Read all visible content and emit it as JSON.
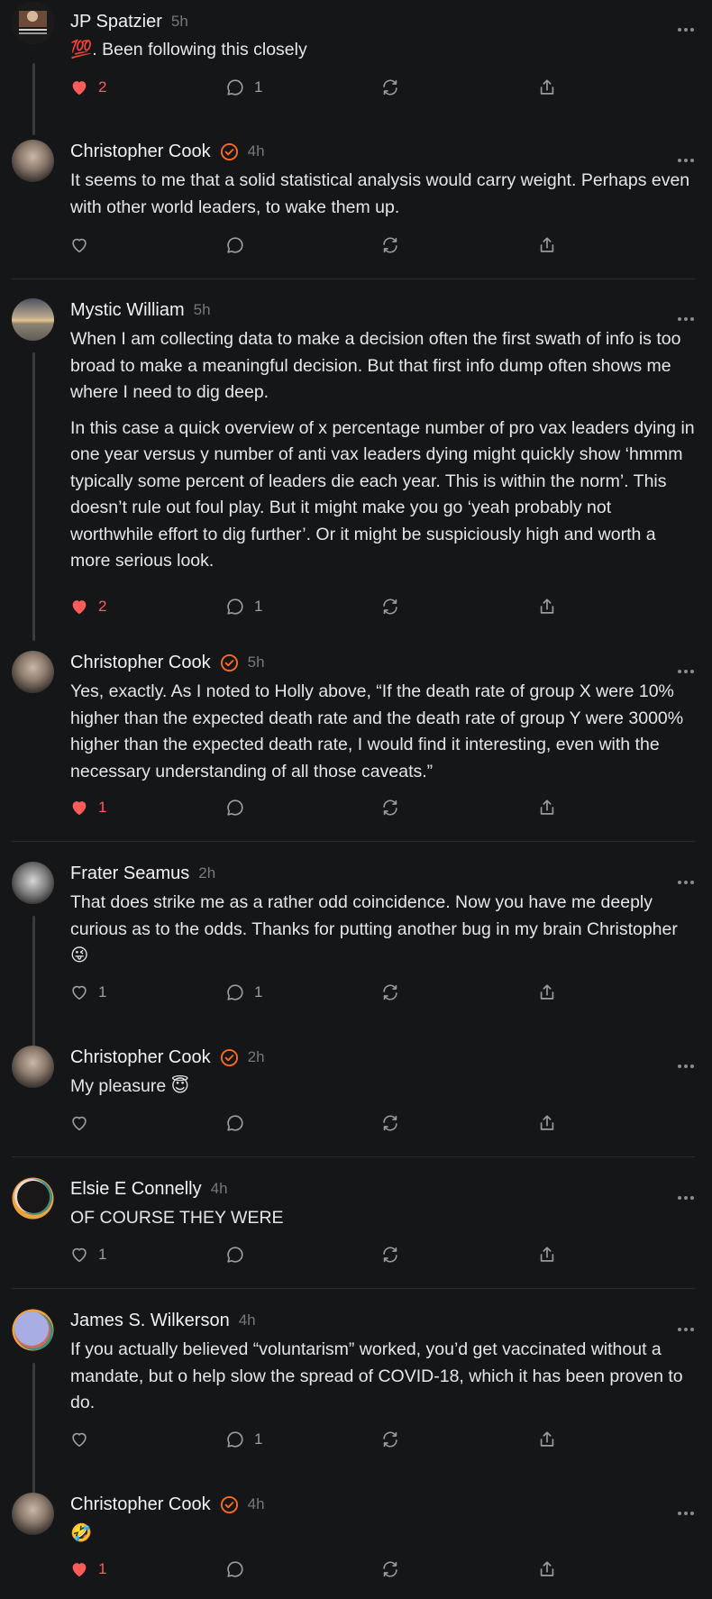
{
  "colors": {
    "background": "#151618",
    "accent_like": "#ff5b5b",
    "verified": "#ff6a1a",
    "muted": "#8b8d91"
  },
  "icons": {
    "like": "heart-icon",
    "comment": "comment-bubble-icon",
    "restack": "restack-icon",
    "share": "share-icon",
    "more": "more-options-icon",
    "verified": "verified-badge-icon"
  },
  "comments": [
    {
      "author": "JP Spatzier",
      "time": "5h",
      "verified": false,
      "text": [
        "💯. Been following this closely"
      ],
      "likes": "2",
      "liked": true,
      "replies": "1"
    },
    {
      "author": "Christopher Cook",
      "time": "4h",
      "verified": true,
      "text": [
        "It seems to me that a solid statistical analysis would carry weight. Perhaps even with other world leaders, to wake them up."
      ],
      "likes": "",
      "liked": false,
      "replies": ""
    },
    {
      "author": "Mystic William",
      "time": "5h",
      "verified": false,
      "text": [
        "When I am collecting data to make a decision often the first swath of info is too broad to make a meaningful decision. But that first info dump often shows me where I need to dig deep.",
        "In this case a quick overview of x percentage number of pro vax leaders dying in one year versus y number of anti vax leaders dying might quickly show ‘hmmm typically some percent of leaders die each year. This is within the norm’. This doesn’t rule out foul play. But it might make you go ‘yeah probably not worthwhile effort to dig further’. Or it might be suspiciously high and worth a more serious look."
      ],
      "likes": "2",
      "liked": true,
      "replies": "1"
    },
    {
      "author": "Christopher Cook",
      "time": "5h",
      "verified": true,
      "text": [
        "Yes, exactly. As I noted to Holly above, “If the death rate of group X were 10% higher than the expected death rate and the death rate of group Y were 3000% higher than the expected death rate, I would find it interesting, even with the necessary understanding of all those caveats.”"
      ],
      "likes": "1",
      "liked": true,
      "replies": ""
    },
    {
      "author": "Frater Seamus",
      "time": "2h",
      "verified": false,
      "text": [
        "That does strike me as a rather odd coincidence. Now you have me deeply curious as to the odds. Thanks for putting another bug in my brain Christopher 😜"
      ],
      "likes": "1",
      "liked": false,
      "replies": "1"
    },
    {
      "author": "Christopher Cook",
      "time": "2h",
      "verified": true,
      "text": [
        "My pleasure 😇"
      ],
      "likes": "",
      "liked": false,
      "replies": ""
    },
    {
      "author": "Elsie E Connelly",
      "time": "4h",
      "verified": false,
      "text": [
        "OF COURSE THEY WERE"
      ],
      "likes": "1",
      "liked": false,
      "replies": ""
    },
    {
      "author": "James S. Wilkerson",
      "time": "4h",
      "verified": false,
      "text": [
        "If you actually believed “voluntarism” worked, you’d get vaccinated without a mandate, but o help slow the spread of COVID-18, which it has been proven to do."
      ],
      "likes": "",
      "liked": false,
      "replies": "1"
    },
    {
      "author": "Christopher Cook",
      "time": "4h",
      "verified": true,
      "text": [
        "🤣"
      ],
      "likes": "1",
      "liked": true,
      "replies": ""
    }
  ]
}
